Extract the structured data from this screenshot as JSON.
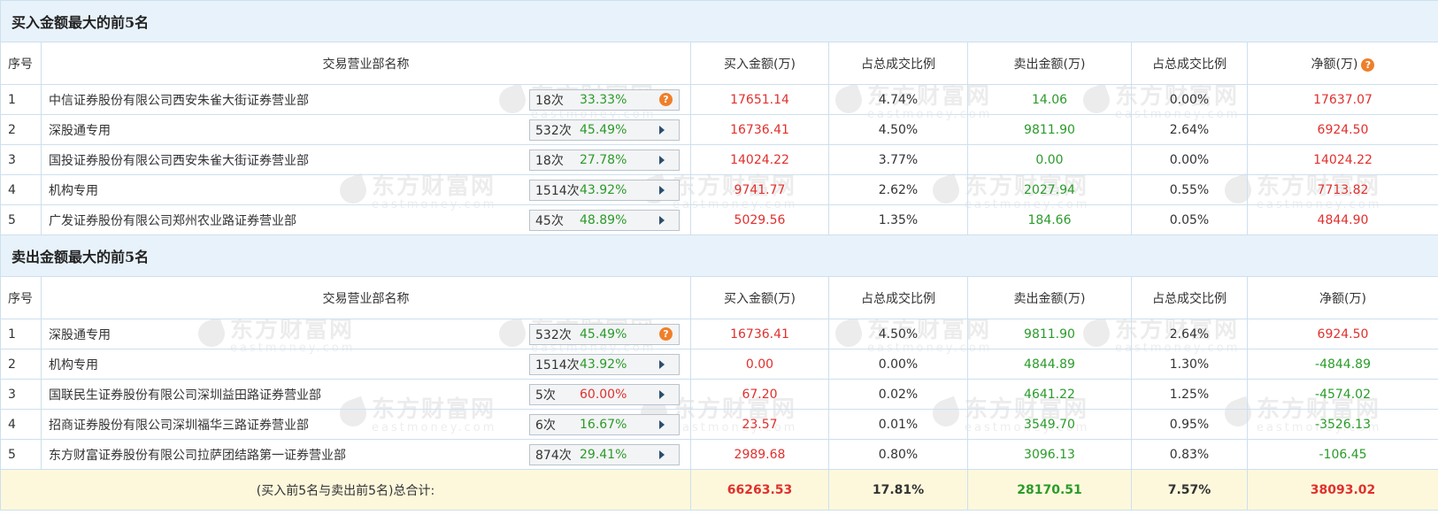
{
  "buy_section": {
    "title": "买入金额最大的前5名",
    "headers": [
      "序号",
      "交易营业部名称",
      "买入金额(万)",
      "占总成交比例",
      "卖出金额(万)",
      "占总成交比例",
      "净额(万)"
    ],
    "rows": [
      {
        "idx": "1",
        "name": "中信证券股份有限公司西安朱雀大街证券营业部",
        "count": "18次",
        "rate": "33.33%",
        "rate_color": "green",
        "buy": "17651.14",
        "buy_pct": "4.74%",
        "sell": "14.06",
        "sell_pct": "0.00%",
        "net": "17637.07",
        "net_color": "red",
        "badge_icon": "question-icon"
      },
      {
        "idx": "2",
        "name": "深股通专用",
        "count": "532次",
        "rate": "45.49%",
        "rate_color": "green",
        "buy": "16736.41",
        "buy_pct": "4.50%",
        "sell": "9811.90",
        "sell_pct": "2.64%",
        "net": "6924.50",
        "net_color": "red",
        "badge_icon": "arrow-right-icon"
      },
      {
        "idx": "3",
        "name": "国投证券股份有限公司西安朱雀大街证券营业部",
        "count": "18次",
        "rate": "27.78%",
        "rate_color": "green",
        "buy": "14024.22",
        "buy_pct": "3.77%",
        "sell": "0.00",
        "sell_pct": "0.00%",
        "net": "14024.22",
        "net_color": "red",
        "badge_icon": "arrow-right-icon"
      },
      {
        "idx": "4",
        "name": "机构专用",
        "count": "1514次",
        "rate": "43.92%",
        "rate_color": "green",
        "buy": "9741.77",
        "buy_pct": "2.62%",
        "sell": "2027.94",
        "sell_pct": "0.55%",
        "net": "7713.82",
        "net_color": "red",
        "badge_icon": "arrow-right-icon"
      },
      {
        "idx": "5",
        "name": "广发证券股份有限公司郑州农业路证券营业部",
        "count": "45次",
        "rate": "48.89%",
        "rate_color": "green",
        "buy": "5029.56",
        "buy_pct": "1.35%",
        "sell": "184.66",
        "sell_pct": "0.05%",
        "net": "4844.90",
        "net_color": "red",
        "badge_icon": "arrow-right-icon"
      }
    ]
  },
  "sell_section": {
    "title": "卖出金额最大的前5名",
    "headers": [
      "序号",
      "交易营业部名称",
      "买入金额(万)",
      "占总成交比例",
      "卖出金额(万)",
      "占总成交比例",
      "净额(万)"
    ],
    "rows": [
      {
        "idx": "1",
        "name": "深股通专用",
        "count": "532次",
        "rate": "45.49%",
        "rate_color": "green",
        "buy": "16736.41",
        "buy_pct": "4.50%",
        "sell": "9811.90",
        "sell_pct": "2.64%",
        "net": "6924.50",
        "net_color": "red",
        "badge_icon": "question-icon"
      },
      {
        "idx": "2",
        "name": "机构专用",
        "count": "1514次",
        "rate": "43.92%",
        "rate_color": "green",
        "buy": "0.00",
        "buy_pct": "0.00%",
        "sell": "4844.89",
        "sell_pct": "1.30%",
        "net": "-4844.89",
        "net_color": "green",
        "badge_icon": "arrow-right-icon"
      },
      {
        "idx": "3",
        "name": "国联民生证券股份有限公司深圳益田路证券营业部",
        "count": "5次",
        "rate": "60.00%",
        "rate_color": "red",
        "buy": "67.20",
        "buy_pct": "0.02%",
        "sell": "4641.22",
        "sell_pct": "1.25%",
        "net": "-4574.02",
        "net_color": "green",
        "badge_icon": "arrow-right-icon"
      },
      {
        "idx": "4",
        "name": "招商证券股份有限公司深圳福华三路证券营业部",
        "count": "6次",
        "rate": "16.67%",
        "rate_color": "green",
        "buy": "23.57",
        "buy_pct": "0.01%",
        "sell": "3549.70",
        "sell_pct": "0.95%",
        "net": "-3526.13",
        "net_color": "green",
        "badge_icon": "arrow-right-icon"
      },
      {
        "idx": "5",
        "name": "东方财富证券股份有限公司拉萨团结路第一证券营业部",
        "count": "874次",
        "rate": "29.41%",
        "rate_color": "green",
        "buy": "2989.68",
        "buy_pct": "0.80%",
        "sell": "3096.13",
        "sell_pct": "0.83%",
        "net": "-106.45",
        "net_color": "green",
        "badge_icon": "arrow-right-icon"
      }
    ]
  },
  "total": {
    "label": "(买入前5名与卖出前5名)总合计:",
    "buy": "66263.53",
    "buy_pct": "17.81%",
    "sell": "28170.51",
    "sell_pct": "7.57%",
    "net": "38093.02"
  },
  "watermark": {
    "cn": "东方财富网",
    "en": "eastmoney.com"
  },
  "colors": {
    "red": "#e0302d",
    "green": "#2a9b2a",
    "section_bg": "#e8f2fa",
    "total_bg": "#fdf8dc",
    "border": "#cde0ee",
    "question_icon": "#ef7f2a"
  }
}
